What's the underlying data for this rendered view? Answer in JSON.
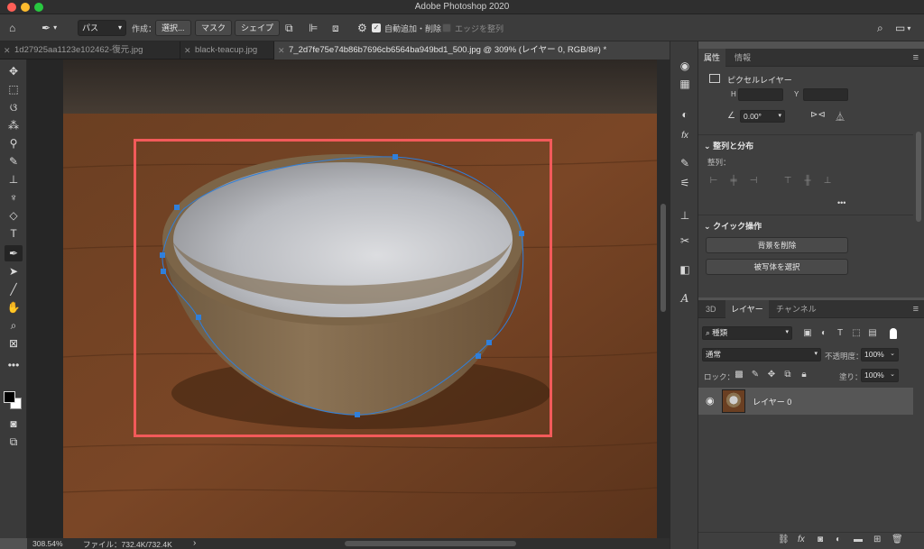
{
  "window": {
    "title": "Adobe Photoshop 2020"
  },
  "options_bar": {
    "mode_value": "パス",
    "create_label": "作成：",
    "select_button": "選択...",
    "mask_button": "マスク",
    "shape_button": "シェイプ",
    "auto_add_delete_label": "自動追加・削除",
    "auto_add_delete_checked": true,
    "align_edges_label": "エッジを整列"
  },
  "tabs": [
    {
      "label": "1d27925aa1123e102462-復元.jpg",
      "active": false
    },
    {
      "label": "black-teacup.jpg",
      "active": false
    },
    {
      "label": "7_2d7fe75e74b86b7696cb6564ba949bd1_500.jpg @ 309% (レイヤー 0, RGB/8#) *",
      "active": true
    }
  ],
  "status": {
    "zoom": "308.54%",
    "file_info": "ファイル：732.4K/732.4K",
    "arrow": "›"
  },
  "properties_panel": {
    "tabs": [
      "属性",
      "情報"
    ],
    "layer_type": "ピクセルレイヤー",
    "h_label": "H",
    "y_label": "Y",
    "angle_value": "0.00°",
    "align_section_title": "整列と分布",
    "align_label": "整列：",
    "more": "•••",
    "quick_actions_title": "クイック操作",
    "remove_bg_button": "背景を削除",
    "select_subject_button": "被写体を選択"
  },
  "layers_panel": {
    "tabs": [
      "3D",
      "レイヤー",
      "チャンネル"
    ],
    "filter_value": "種類",
    "blend_mode": "通常",
    "opacity_label": "不透明度：",
    "opacity_value": "100%",
    "lock_label": "ロック：",
    "fill_label": "塗り：",
    "fill_value": "100%",
    "layers": [
      {
        "name": "レイヤー 0",
        "visible": true
      }
    ]
  },
  "colors": {
    "selection_rect": "#f25a5a",
    "path_stroke": "#2f7fdb",
    "anchor": "#2f7fdb",
    "traffic_red": "#ff5f57",
    "traffic_yellow": "#febc2e",
    "traffic_green": "#28c840"
  }
}
